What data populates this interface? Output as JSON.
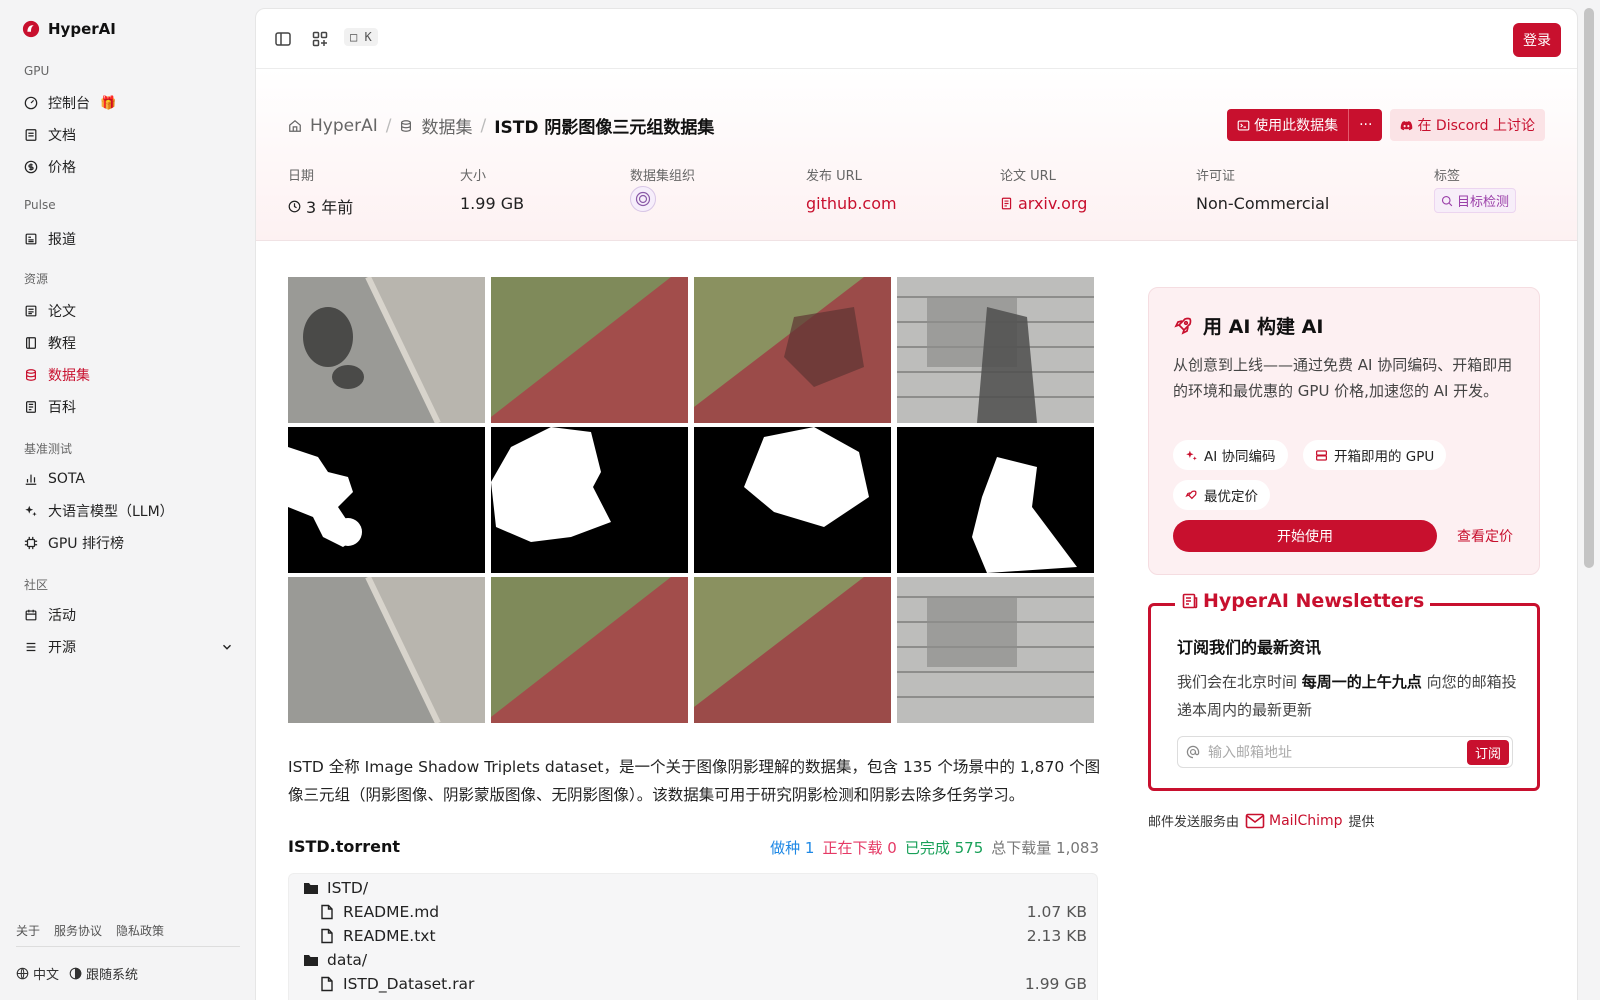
{
  "brand": {
    "name": "HyperAI"
  },
  "sidebar": {
    "sections": [
      {
        "title": "GPU",
        "items": [
          {
            "label": "控制台"
          },
          {
            "label": "文档"
          },
          {
            "label": "价格"
          }
        ]
      },
      {
        "title": "Pulse",
        "items": [
          {
            "label": "报道"
          }
        ]
      },
      {
        "title": "资源",
        "items": [
          {
            "label": "论文"
          },
          {
            "label": "教程"
          },
          {
            "label": "数据集",
            "active": true
          },
          {
            "label": "百科"
          }
        ]
      },
      {
        "title": "基准测试",
        "items": [
          {
            "label": "SOTA"
          },
          {
            "label": "大语言模型（LLM）"
          },
          {
            "label": "GPU 排行榜"
          }
        ]
      },
      {
        "title": "社区",
        "items": [
          {
            "label": "活动"
          },
          {
            "label": "开源"
          }
        ]
      }
    ],
    "footer_links": [
      "关于",
      "服务协议",
      "隐私政策"
    ],
    "language": "中文",
    "theme": "跟随系统"
  },
  "topbar": {
    "shortcut": "□ K",
    "login_label": "登录"
  },
  "breadcrumb": {
    "home": "HyperAI",
    "section": "数据集",
    "current": "ISTD 阴影图像三元组数据集"
  },
  "actions": {
    "use_dataset": "使用此数据集",
    "more": "···",
    "discord": "在 Discord 上讨论"
  },
  "meta": {
    "date_label": "日期",
    "date_value": "3 年前",
    "size_label": "大小",
    "size_value": "1.99 GB",
    "org_label": "数据集组织",
    "release_label": "发布 URL",
    "release_value": "github.com",
    "paper_label": "论文 URL",
    "paper_value": "arxiv.org",
    "license_label": "许可证",
    "license_value": "Non-Commercial",
    "tags_label": "标签",
    "tag_value": "目标检测"
  },
  "description": "ISTD 全称 Image Shadow Triplets dataset，是一个关于图像阴影理解的数据集，包含 135 个场景中的 1,870 个图像三元组（阴影图像、阴影蒙版图像、无阴影图像）。该数据集可用于研究阴影检测和阴影去除多任务学习。",
  "torrent": {
    "title": "ISTD.torrent",
    "seeds_label": "做种",
    "seeds": "1",
    "downloading_label": "正在下载",
    "downloading": "0",
    "completed_label": "已完成",
    "completed": "575",
    "total_label": "总下载量",
    "total": "1,083",
    "files": [
      {
        "name": "ISTD/",
        "type": "folder",
        "indent": 0,
        "size": ""
      },
      {
        "name": "README.md",
        "type": "file",
        "indent": 1,
        "size": "1.07 KB"
      },
      {
        "name": "README.txt",
        "type": "file",
        "indent": 1,
        "size": "2.13 KB"
      },
      {
        "name": "data/",
        "type": "folder",
        "indent": 0,
        "size": ""
      },
      {
        "name": "ISTD_Dataset.rar",
        "type": "file",
        "indent": 1,
        "size": "1.99 GB"
      }
    ]
  },
  "ai_card": {
    "title": "用 AI 构建 AI",
    "text": "从创意到上线——通过免费 AI 协同编码、开箱即用的环境和最优惠的 GPU 价格,加速您的 AI 开发。",
    "chips": [
      "AI 协同编码",
      "开箱即用的 GPU",
      "最优定价"
    ],
    "start_label": "开始使用",
    "pricing_label": "查看定价"
  },
  "newsletter": {
    "title": "HyperAI Newsletters",
    "heading": "订阅我们的最新资讯",
    "text_before": "我们会在北京时间 ",
    "text_bold": "每周一的上午九点",
    "text_after": " 向您的邮箱投递本周内的最新更新",
    "placeholder": "输入邮箱地址",
    "subscribe_label": "订阅",
    "provider_prefix": "邮件发送服务由",
    "provider": "MailChimp",
    "provider_suffix": "提供"
  },
  "colors": {
    "brand": "#c8102e",
    "accent_pink": "#fdf0f2"
  }
}
